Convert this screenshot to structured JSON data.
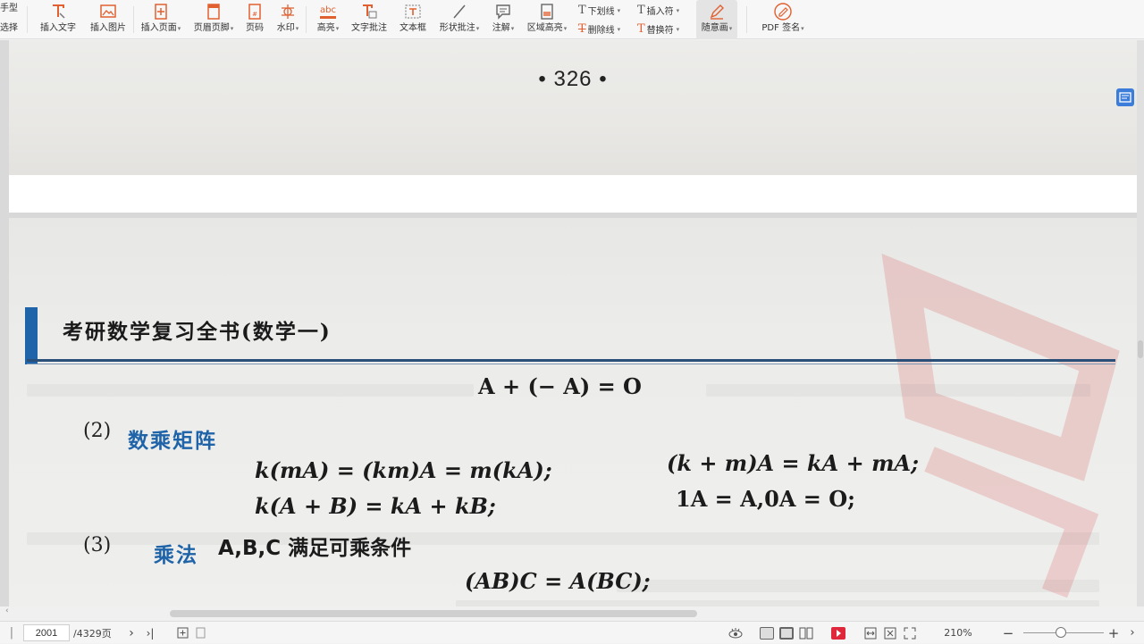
{
  "toolbar": {
    "left_cut_top": "手型",
    "left_cut_bottom": "选择",
    "items": [
      {
        "label": "插入文字"
      },
      {
        "label": "插入图片"
      },
      {
        "label": "插入页面"
      },
      {
        "label": "页眉页脚"
      },
      {
        "label": "页码"
      },
      {
        "label": "水印"
      },
      {
        "label": "高亮"
      },
      {
        "label": "文字批注"
      },
      {
        "label": "文本框"
      },
      {
        "label": "形状批注"
      },
      {
        "label": "注解"
      },
      {
        "label": "区域高亮"
      }
    ],
    "underline": "下划线",
    "strikethrough": "删除线",
    "insert_mark": "插入符",
    "replace_mark": "替换符",
    "freehand": "随意画",
    "pdf_sign": "PDF 签名",
    "highlight_icon_text": "abc"
  },
  "document": {
    "prev_page_number": "• 326 •",
    "book_header": "考研数学复习全书(数学一)",
    "line_identity": "A + (− A) = O",
    "section2_num": "(2)",
    "section2_title": "数乘矩阵",
    "eq1_left": "k(mA) = (km)A = m(kA);",
    "eq1_right": "(k + m)A = kA + mA;",
    "eq2_left": "k(A + B) = kA + kB;",
    "eq2_right": "1A = A,0A = O;",
    "section3_num": "(3)",
    "section3_title": "乘法",
    "section3_text": "A,B,C 满足可乘条件",
    "eq3": "(AB)C = A(BC);"
  },
  "status": {
    "current_page": "2001",
    "total_pages": "/4329页",
    "zoom": "210%"
  },
  "colors": {
    "accent_blue": "#1f63a8",
    "record_red": "#e0263a"
  }
}
